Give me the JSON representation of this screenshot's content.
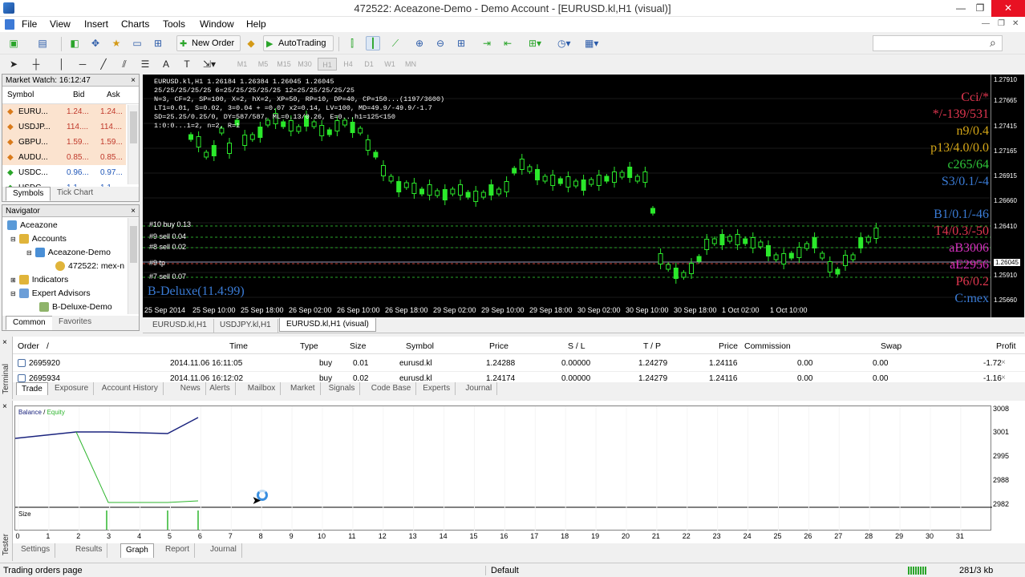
{
  "window": {
    "title": "472522: Aceazone-Demo - Demo Account - [EURUSD.kl,H1 (visual)]",
    "min": "—",
    "restore": "❐",
    "close": "✕",
    "inner_min": "—",
    "inner_restore": "❐",
    "inner_close": "✕"
  },
  "menu": [
    "File",
    "View",
    "Insert",
    "Charts",
    "Tools",
    "Window",
    "Help"
  ],
  "toolbar": {
    "new_order": "New Order",
    "autotrading": "AutoTrading",
    "search_icon": "⌕",
    "timeframes": [
      "M1",
      "M5",
      "M15",
      "M30",
      "H1",
      "H4",
      "D1",
      "W1",
      "MN"
    ]
  },
  "market_watch": {
    "title": "Market Watch: 16:12:47",
    "close": "×",
    "cols": [
      "Symbol",
      "Bid",
      "Ask"
    ],
    "rows": [
      {
        "sym": "EURU...",
        "bid": "1.24...",
        "ask": "1.24..."
      },
      {
        "sym": "USDJP...",
        "bid": "114....",
        "ask": "114...."
      },
      {
        "sym": "GBPU...",
        "bid": "1.59...",
        "ask": "1.59..."
      },
      {
        "sym": "AUDU...",
        "bid": "0.85...",
        "ask": "0.85..."
      },
      {
        "sym": "USDC...",
        "bid": "0.96...",
        "ask": "0.97..."
      },
      {
        "sym": "USDC...",
        "bid": "1.1...",
        "ask": "1.1..."
      }
    ],
    "tabs": [
      "Symbols",
      "Tick Chart"
    ]
  },
  "navigator": {
    "title": "Navigator",
    "close": "×",
    "items": [
      "Aceazone",
      "Accounts",
      "Aceazone-Demo",
      "472522: mex-n",
      "Indicators",
      "Expert Advisors",
      "B-Deluxe-Demo"
    ],
    "tabs": [
      "Common",
      "Favorites"
    ]
  },
  "chart": {
    "info_lines": [
      "EURUSD.kl,H1  1.26184  1.26384  1.26045  1.26045",
      "25/25/25/25/25 6=25/25/25/25/25 12=25/25/25/25/25",
      "N=3, CF=2, SP=100, X=2, hX=2, XP=50, RP=10, DP=40, CP=150...(1197/3600)",
      "LT1=0.01, S=0.02, 3=0.04 + =0.07 x2=0.14, LV=100, MD=49.9/-49.9/-1.7",
      "SD=25.25/0.25/0, DY=587/587, ML=0.13/0.26, E=0...h1=125<150",
      "1:0:0...1=2, n=2, R=1"
    ],
    "indicators": [
      {
        "t": "Cci/*",
        "c": "#e0364f"
      },
      {
        "t": "*/-139/531",
        "c": "#e0364f"
      },
      {
        "t": "n9/0.4",
        "c": "#d4a617"
      },
      {
        "t": "p13/4.0/0.0",
        "c": "#d4a617"
      },
      {
        "t": "c265/64",
        "c": "#2fc73a"
      },
      {
        "t": "S3/0.1/-4",
        "c": "#3a7bd5"
      },
      {
        "t": "B1/0.1/-46",
        "c": "#3a7bd5"
      },
      {
        "t": "T4/0.3/-50",
        "c": "#e0364f"
      },
      {
        "t": "aB3006",
        "c": "#d62fbf"
      },
      {
        "t": "aE2956",
        "c": "#d62fbf"
      },
      {
        "t": "P6/0.2",
        "c": "#e0364f"
      },
      {
        "t": "C:mex",
        "c": "#3a7bd5"
      }
    ],
    "ea_label": "B-Deluxe(11.4:99)",
    "orders": [
      "#10 buy 0.13",
      "#9 sell 0.04",
      "#8 sell 0.02",
      "#9 tp",
      "#7 sell 0.07"
    ],
    "prices": [
      "1.27910",
      "1.27665",
      "1.27415",
      "1.27165",
      "1.26915",
      "1.26660",
      "1.26410",
      "1.26045",
      "1.25910",
      "1.25660"
    ],
    "time_labels": [
      "25 Sep 2014",
      "25 Sep 10:00",
      "25 Sep 18:00",
      "26 Sep 02:00",
      "26 Sep 10:00",
      "26 Sep 18:00",
      "29 Sep 02:00",
      "29 Sep 10:00",
      "29 Sep 18:00",
      "30 Sep 02:00",
      "30 Sep 10:00",
      "30 Sep 18:00",
      "1 Oct 02:00",
      "1 Oct 10:00"
    ],
    "tabs": [
      "EURUSD.kl,H1",
      "USDJPY.kl,H1",
      "EURUSD.kl,H1 (visual)"
    ]
  },
  "terminal": {
    "label": "Terminal",
    "cols": [
      "Order",
      "/",
      "Time",
      "Type",
      "Size",
      "Symbol",
      "Price",
      "S / L",
      "T / P",
      "Price",
      "Commission",
      "Swap",
      "Profit"
    ],
    "rows": [
      [
        "2695920",
        "2014.11.06 16:11:05",
        "buy",
        "0.01",
        "eurusd.kl",
        "1.24288",
        "0.00000",
        "1.24279",
        "1.24116",
        "0.00",
        "0.00",
        "-1.72"
      ],
      [
        "2695934",
        "2014.11.06 16:12:02",
        "buy",
        "0.02",
        "eurusd.kl",
        "1.24174",
        "0.00000",
        "1.24279",
        "1.24116",
        "0.00",
        "0.00",
        "-1.16"
      ]
    ],
    "tabs": [
      "Trade",
      "Exposure",
      "Account History",
      "News",
      "Alerts",
      "Mailbox",
      "Market",
      "Signals",
      "Code Base",
      "Experts",
      "Journal"
    ]
  },
  "tester": {
    "label": "Tester",
    "legend_balance": "Balance",
    "legend_sep": " / ",
    "legend_equity": "Equity",
    "size_label": "Size",
    "y_ticks": [
      "3008",
      "3001",
      "2995",
      "2988",
      "2982"
    ],
    "x_ticks": [
      "0",
      "1",
      "2",
      "3",
      "4",
      "5",
      "6",
      "7",
      "8",
      "9",
      "10",
      "11",
      "12",
      "13",
      "14",
      "15",
      "16",
      "17",
      "18",
      "19",
      "20",
      "21",
      "22",
      "23",
      "24",
      "25",
      "26",
      "27",
      "28",
      "29",
      "30",
      "31"
    ],
    "tabs": [
      "Settings",
      "Results",
      "Graph",
      "Report",
      "Journal"
    ],
    "colors": {
      "balance": "#1a237e",
      "equity": "#2db52d"
    }
  },
  "status": {
    "left": "Trading orders page",
    "profile": "Default",
    "traffic": "281/3 kb"
  }
}
